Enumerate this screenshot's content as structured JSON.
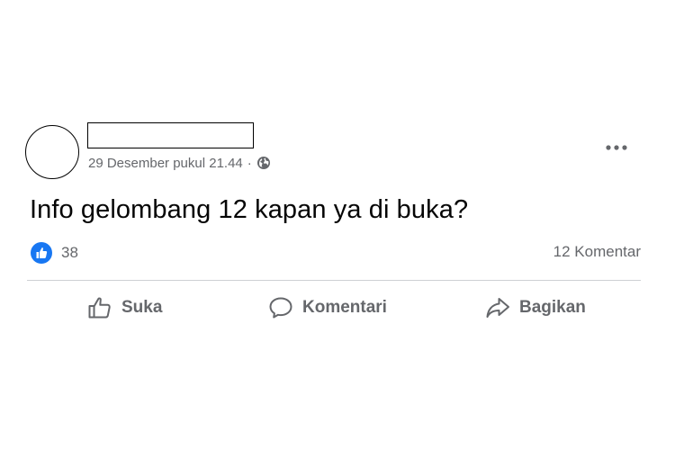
{
  "post": {
    "author_name": "",
    "timestamp": "29 Desember pukul 21.44",
    "separator": "·",
    "audience_icon": "globe-icon",
    "more_icon": "more-options-icon",
    "text": "Info gelombang 12 kapan ya di buka?",
    "reactions": {
      "icon": "like-reaction-icon",
      "count": "38"
    },
    "comments_count_label": "12 Komentar"
  },
  "actions": {
    "like_label": "Suka",
    "comment_label": "Komentari",
    "share_label": "Bagikan"
  },
  "colors": {
    "text_primary": "#050505",
    "text_secondary": "#65676b",
    "like_blue": "#1877f2",
    "divider": "#ced0d4"
  }
}
